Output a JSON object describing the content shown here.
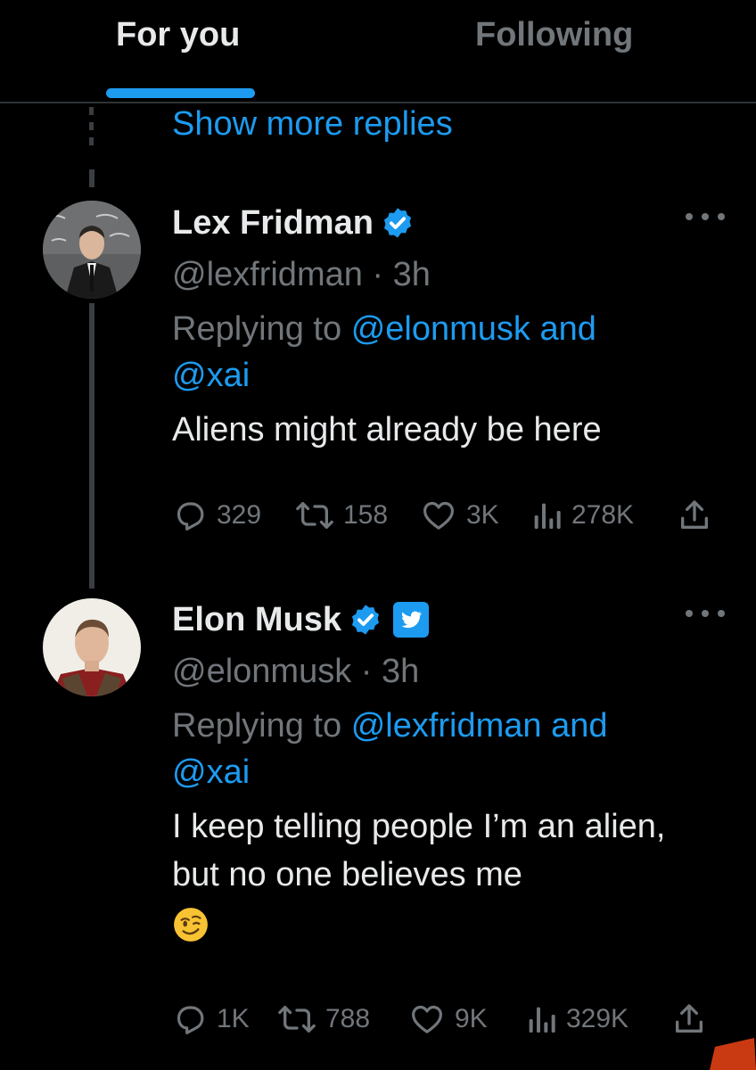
{
  "tabs": {
    "for_you": "For you",
    "following": "Following"
  },
  "show_more_replies": "Show more replies",
  "tweets": [
    {
      "name": "Lex Fridman",
      "handle": "@lexfridman",
      "time": "3h",
      "replying_prefix": "Replying to",
      "mention_1": "@elonmusk",
      "and": "and",
      "mention_2": "@xai",
      "text": "Aliens might already be here",
      "replies": "329",
      "retweets": "158",
      "likes": "3K",
      "views": "278K"
    },
    {
      "name": "Elon Musk",
      "handle": "@elonmusk",
      "time": "3h",
      "replying_prefix": "Replying to",
      "mention_1": "@lexfridman",
      "and": "and",
      "mention_2": "@xai",
      "text": "I keep telling people I’m an alien, but no one believes me",
      "emoji": "winking-face",
      "replies": "1K",
      "retweets": "788",
      "likes": "9K",
      "views": "329K"
    }
  ],
  "colors": {
    "background": "#000000",
    "primary_text": "#e7e9ea",
    "secondary_text": "#71767b",
    "accent": "#1d9bf0",
    "divider": "#2f3336"
  }
}
